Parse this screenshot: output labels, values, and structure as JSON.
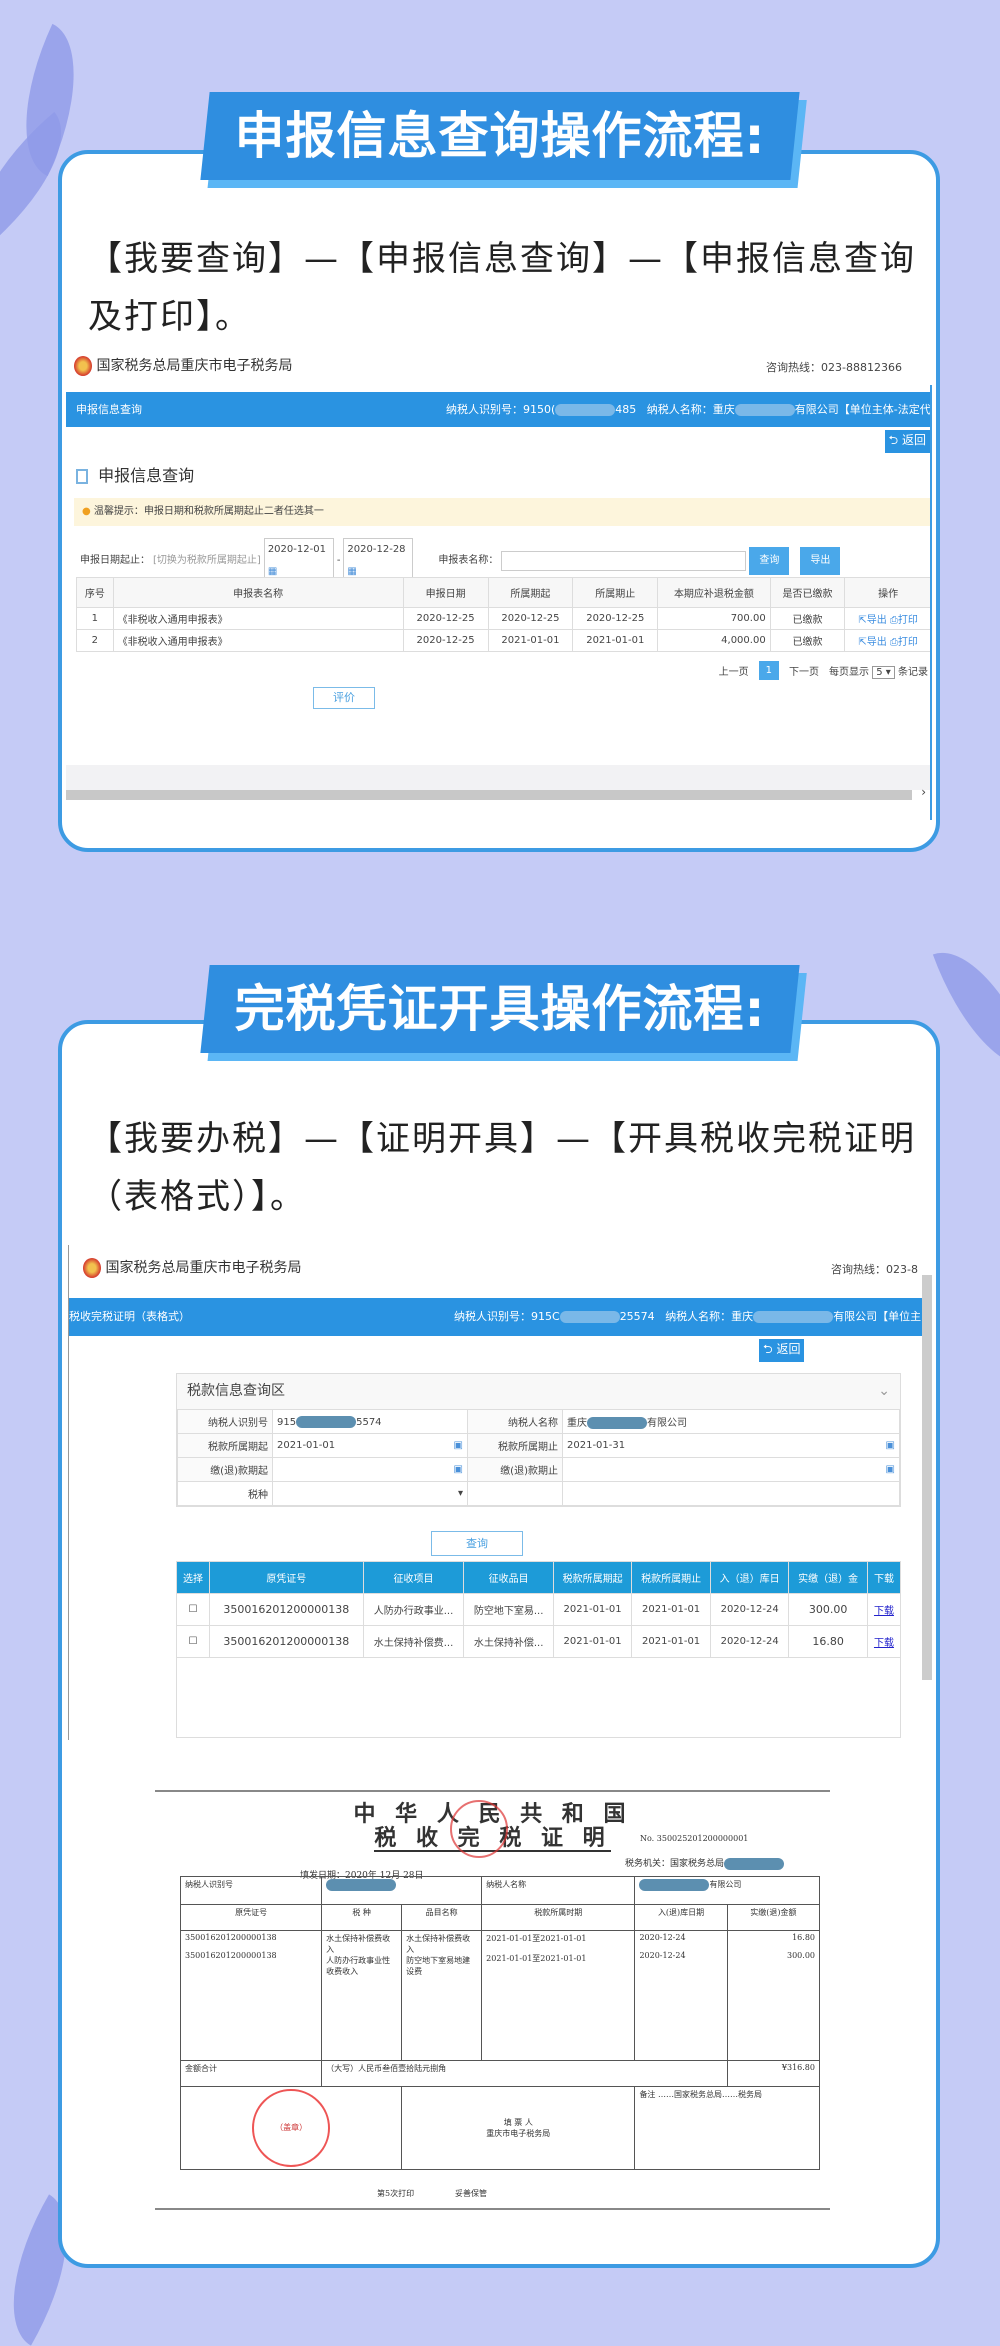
{
  "section1": {
    "banner": "申报信息查询操作流程:",
    "instruction": "【我要查询】—【申报信息查询】—【申报信息查询及打印】。",
    "screenshot": {
      "site_name": "国家税务总局重庆市电子税务局",
      "hotline": "咨询热线：023-88812366",
      "nav_title": "申报信息查询",
      "taxpayer_id_label": "纳税人识别号：9150(",
      "taxpayer_id_suffix": "485",
      "taxpayer_name_label": "纳税人名称：重庆",
      "taxpayer_name_suffix": "有限公司【单位主体-法定代表人】",
      "return_label": "返回",
      "page_title": "申报信息查询",
      "notice": "温馨提示：申报日期和税款所属期起止二者任选其一",
      "date_label": "申报日期起止：",
      "switch_link": "[切换为税款所属期起止]",
      "date_from": "2020-12-01",
      "date_to": "2020-12-28",
      "form_name_label": "申报表名称：",
      "form_name_value": "",
      "query_label": "查询",
      "export_label": "导出",
      "columns": [
        "序号",
        "申报表名称",
        "申报日期",
        "所属期起",
        "所属期止",
        "本期应补退税金额",
        "是否已缴款",
        "操作"
      ],
      "rows": [
        [
          "1",
          "《非税收入通用申报表》",
          "2020-12-25",
          "2020-12-25",
          "2020-12-25",
          "700.00",
          "已缴款"
        ],
        [
          "2",
          "《非税收入通用申报表》",
          "2020-12-25",
          "2021-01-01",
          "2021-01-01",
          "4,000.00",
          "已缴款"
        ]
      ],
      "action_export": "导出",
      "action_print": "打印",
      "prev": "上一页",
      "page": "1",
      "next": "下一页",
      "per_page_label": "每页显示",
      "per_page": "5",
      "records_label": "条记录",
      "rate_label": "评价"
    }
  },
  "section2": {
    "banner": "完税凭证开具操作流程:",
    "instruction": "【我要办税】—【证明开具】—【开具税收完税证明（表格式）】。",
    "screenshot": {
      "site_name": "国家税务总局重庆市电子税务局",
      "hotline": "咨询热线：023-8",
      "nav_title": "税收完税证明（表格式）",
      "taxpayer_id_label": "纳税人识别号：915C",
      "taxpayer_id_suffix": "25574",
      "taxpayer_name_label": "纳税人名称：重庆",
      "taxpayer_name_suffix": "有限公司【单位主",
      "return_label": "返回",
      "panel_title": "税款信息查询区",
      "fields": {
        "id_label": "纳税人识别号",
        "id_value_prefix": "915",
        "id_value_suffix": "5574",
        "name_label": "纳税人名称",
        "name_value_prefix": "重庆",
        "name_value_suffix": "有限公司",
        "period_from_label": "税款所属期起",
        "period_from": "2021-01-01",
        "period_to_label": "税款所属期止",
        "period_to": "2021-01-31",
        "pay_from_label": "缴(退)款期起",
        "pay_to_label": "缴(退)款期止",
        "tax_type_label": "税种"
      },
      "query_label": "查询",
      "columns": [
        "选择",
        "原凭证号",
        "征收项目",
        "征收品目",
        "税款所属期起",
        "税款所属期止",
        "入（退）库日",
        "实缴（退）金",
        "下载"
      ],
      "rows": [
        [
          "350016201200000138",
          "人防办行政事业...",
          "防空地下室易...",
          "2021-01-01",
          "2021-01-01",
          "2020-12-24",
          "300.00",
          "下载"
        ],
        [
          "350016201200000138",
          "水土保持补偿费...",
          "水土保持补偿...",
          "2021-01-01",
          "2021-01-01",
          "2020-12-24",
          "16.80",
          "下载"
        ]
      ]
    },
    "certificate": {
      "title_line1": "中 华 人 民 共 和 国",
      "title_line2": "税 收 完 税 证 明",
      "number": "No. 350025201200000001",
      "fill_date": "填发日期：2020年 12月 28日",
      "authority": "税务机关：国家税务总局",
      "taxpayer_id_label": "纳税人识别号",
      "taxpayer_name_label": "纳税人名称",
      "taxpayer_name_suffix": "有限公司",
      "columns": [
        "原凭证号",
        "税 种",
        "品目名称",
        "税款所属时期",
        "入(退)库日期",
        "实缴(退)金额"
      ],
      "rows": [
        [
          "350016201200000138",
          "水土保持补偿费收入",
          "水土保持补偿费收入",
          "2021-01-01至2021-01-01",
          "2020-12-24",
          "16.80"
        ],
        [
          "350016201200000138",
          "人防办行政事业性收费收入",
          "防空地下室易地建设费",
          "2021-01-01至2021-01-01",
          "2020-12-24",
          "300.00"
        ]
      ],
      "total_label": "金额合计",
      "total_words": "（大写）人民币叁佰壹拾陆元捌角",
      "total_value": "¥316.80",
      "stamp_text": "（盖章）",
      "drawer_label": "填 票 人",
      "drawer_value": "重庆市电子税务局",
      "remarks": "备注 ……国家税务总局……税务局",
      "print_count": "第5次打印",
      "keep_note": "妥善保管"
    }
  }
}
